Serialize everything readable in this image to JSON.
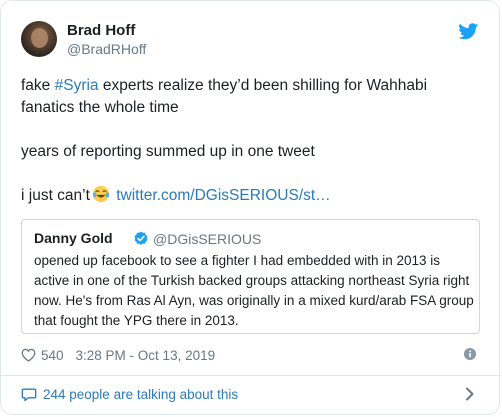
{
  "author": {
    "name": "Brad Hoff",
    "handle": "@BradRHoff"
  },
  "tweet": {
    "line1_prefix": "fake ",
    "hashtag": "#Syria",
    "line1_suffix": " experts realize they’d been shilling for Wahhabi fanatics the whole time",
    "line2": "years of reporting summed up in one tweet",
    "line3_prefix": "i just can’t",
    "link": "twitter.com/DGisSERIOUS/st…"
  },
  "quoted": {
    "name": "Danny Gold",
    "handle": "@DGisSERIOUS",
    "text": "opened up facebook to see a fighter I had embedded with in 2013 is active in one of the Turkish backed groups attacking northeast Syria right now. He's from Ras Al Ayn, was originally in a mixed kurd/arab FSA group that fought the YPG there in 2013."
  },
  "meta": {
    "likes": "540",
    "timestamp": "3:28 PM - Oct 13, 2019"
  },
  "footer": {
    "talking": "244 people are talking about this"
  },
  "colors": {
    "link": "#2b7bb9",
    "muted": "#697882",
    "text": "#1c2022",
    "twitter_blue": "#1da1f2"
  },
  "icons": {
    "bird": "twitter-bird-icon",
    "verified": "verified-badge-icon",
    "heart": "heart-icon",
    "info": "info-icon",
    "bubble": "speech-bubble-icon",
    "chevron": "chevron-right-icon",
    "emoji": "tears-of-joy-emoji"
  }
}
